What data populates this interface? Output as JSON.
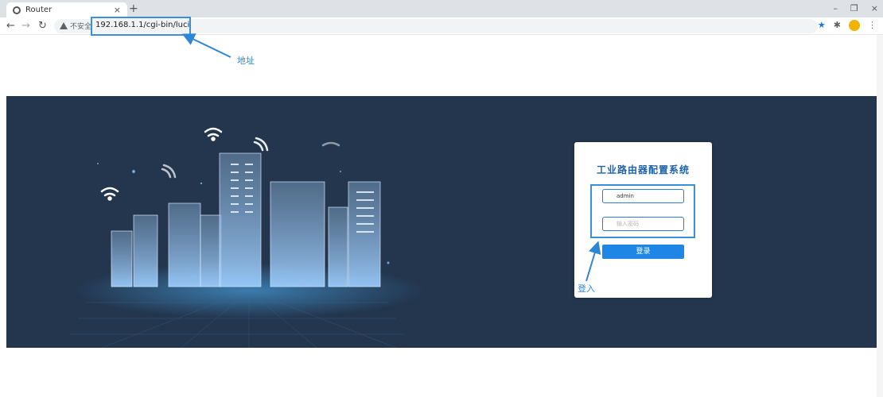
{
  "browser": {
    "tab_title": "Router",
    "tab_close": "×",
    "new_tab": "+",
    "security_label": "不安全",
    "url": "192.168.1.1/cgi-bin/luci",
    "window_controls": [
      "–",
      "❐",
      "×"
    ]
  },
  "annotations": {
    "address_label": "地址",
    "login_label": "登入"
  },
  "login": {
    "title": "工业路由器配置系统",
    "username_value": "admin",
    "password_placeholder": "输入密码",
    "submit_label": "登录"
  },
  "colors": {
    "hero_background": "#23364e",
    "accent": "#1f86e6",
    "annotation": "#2f86d4"
  }
}
